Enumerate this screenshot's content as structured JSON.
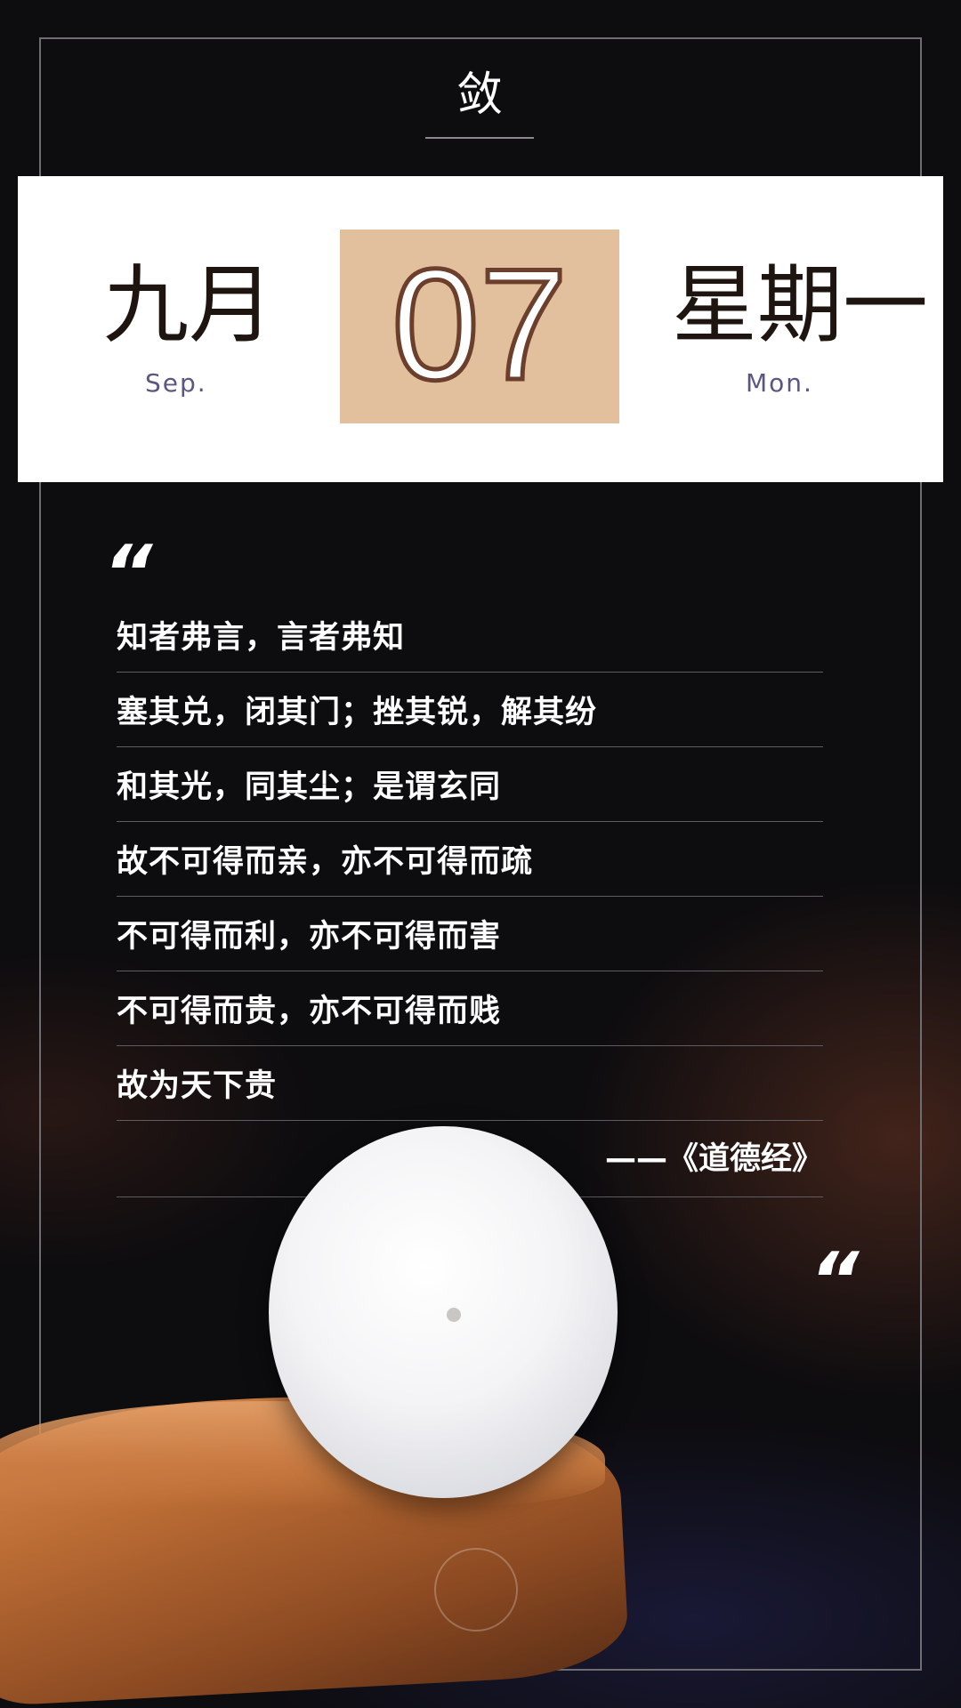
{
  "header": {
    "title": "敛"
  },
  "date": {
    "month_cn": "九月",
    "month_en": "Sep.",
    "day": "07",
    "weekday_cn": "星期一",
    "weekday_en": "Mon."
  },
  "quote": {
    "open_mark": "“",
    "close_mark": "“",
    "lines": [
      "知者弗言，言者弗知",
      "塞其兑，闭其门；挫其锐，解其纷",
      "和其光，同其尘；是谓玄同",
      "故不可得而亲，亦不可得而疏",
      "不可得而利，亦不可得而害",
      "不可得而贵，亦不可得而贱",
      "故为天下贵"
    ],
    "source": "——《道德经》"
  },
  "colors": {
    "background": "#0d0c0f",
    "day_box": "#e2bf9d",
    "day_stroke": "#6b3f2c",
    "english_label": "#5a5680"
  }
}
